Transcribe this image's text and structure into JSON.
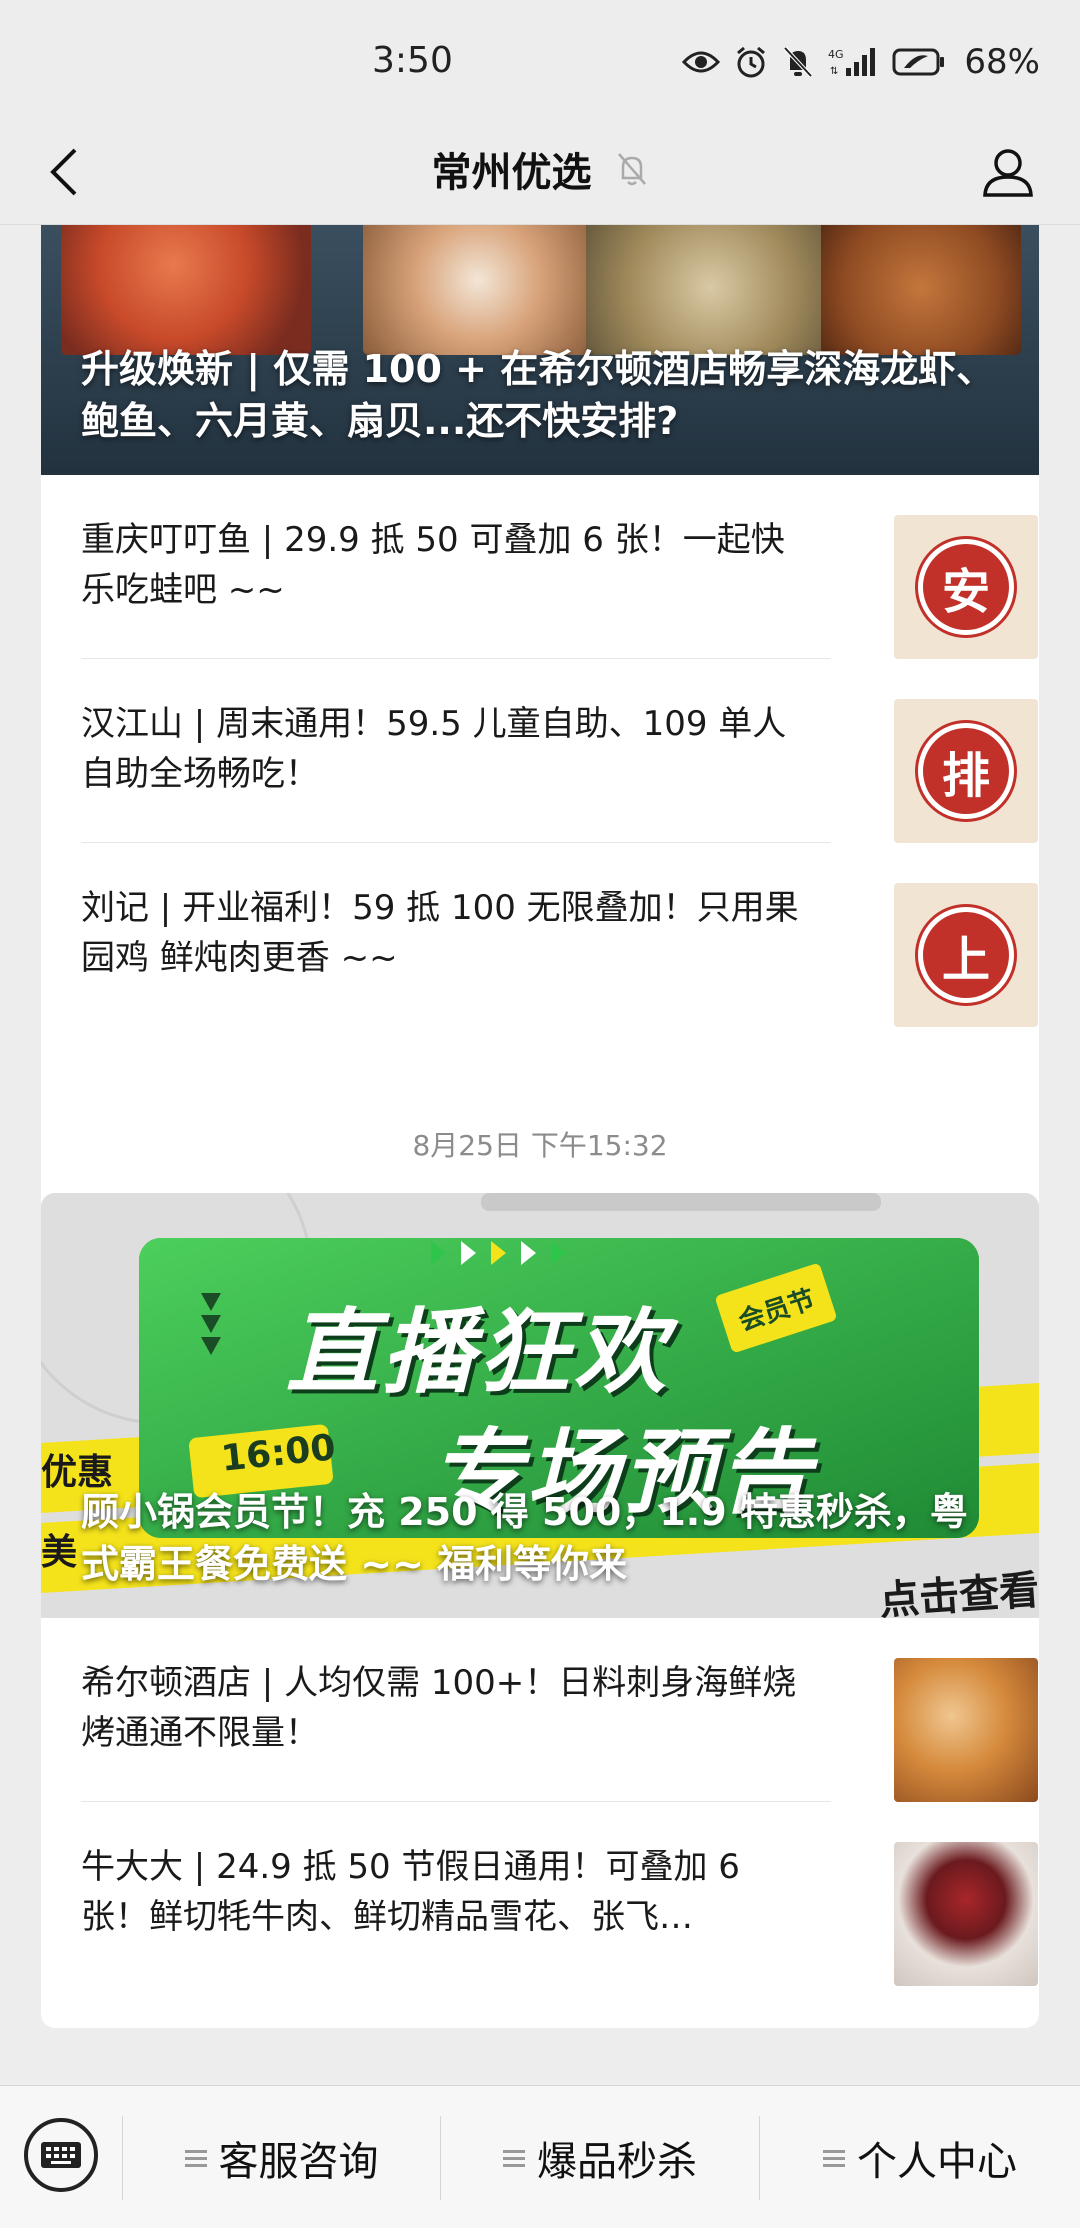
{
  "status": {
    "time": "3:50",
    "battery": "68%"
  },
  "nav": {
    "title": "常州优选"
  },
  "articles_group_1": {
    "cover_title": "升级焕新 | 仅需 100 + 在希尔顿酒店畅享深海龙虾、鲍鱼、六月黄、扇贝...还不快安排?",
    "items": [
      {
        "title": "重庆叮叮鱼 | 29.9 抵 50 可叠加 6 张！一起快乐吃蛙吧 ~~",
        "thumb_char": "安"
      },
      {
        "title": "汉江山 | 周末通用！59.5 儿童自助、109 单人自助全场畅吃！",
        "thumb_char": "排"
      },
      {
        "title": "刘记 | 开业福利！59 抵 100 无限叠加！只用果园鸡 鲜炖肉更香 ~~",
        "thumb_char": "上"
      }
    ]
  },
  "timestamp": "8月25日 下午15:32",
  "articles_group_2": {
    "cover_banner_line1": "直播狂欢",
    "cover_banner_line2": "专场预告",
    "cover_badge": "会员节",
    "cover_time": "16:00",
    "cover_side_left": "优惠",
    "cover_side_left2": "美",
    "cover_side_right": "点击查看",
    "cover_title": "顾小锅会员节！充 250 得 500，1.9 特惠秒杀，粤式霸王餐免费送 ~~ 福利等你来",
    "items": [
      {
        "title": "希尔顿酒店 | 人均仅需 100+！日料刺身海鲜烧烤通通不限量！"
      },
      {
        "title": "牛大大 | 24.9 抵 50 节假日通用！可叠加 6 张！鲜切牦牛肉、鲜切精品雪花、张飞…"
      }
    ]
  },
  "menu": {
    "items": [
      "客服咨询",
      "爆品秒杀",
      "个人中心"
    ]
  },
  "colors": {
    "stamp_red": "#c2302a",
    "banner_green": "#33b24a",
    "banner_yellow": "#f4e31b"
  }
}
